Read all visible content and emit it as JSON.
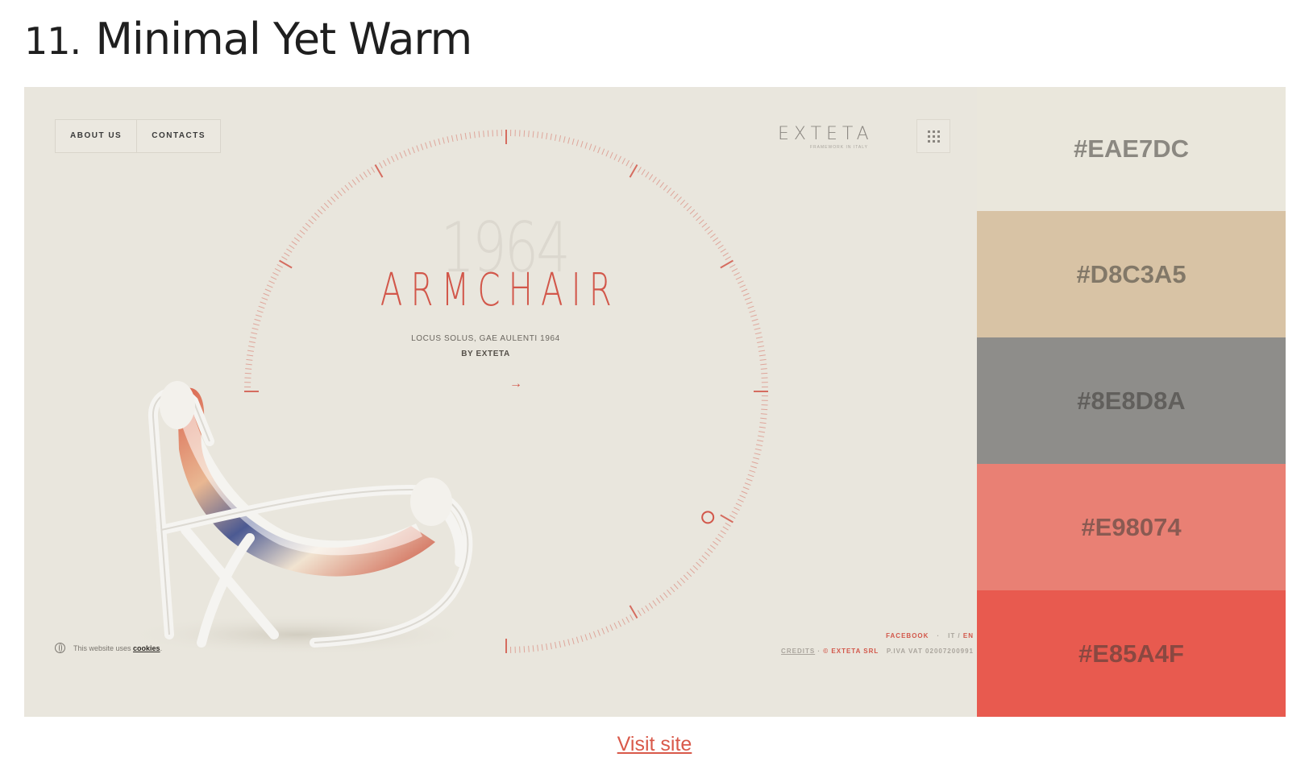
{
  "article": {
    "number": "11.",
    "title": "Minimal Yet Warm",
    "visit_link": "Visit site"
  },
  "site": {
    "nav": [
      "ABOUT US",
      "CONTACTS"
    ],
    "logo": "EXTETA",
    "logo_tagline": "FRAMEWORK IN ITALY",
    "menu_icon": "grid-dots-icon",
    "year": "1964",
    "product_title": "ARMCHAIR",
    "subtitle": "LOCUS SOLUS, GAE AULENTI 1964",
    "byline": "BY EXTETA",
    "arrow": "→",
    "cookie_text": "This website uses",
    "cookie_link": "cookies",
    "footer": {
      "facebook": "FACEBOOK",
      "separator": "·",
      "lang_it": "IT",
      "lang_slash": " / ",
      "lang_en": "EN",
      "credits": "CREDITS",
      "company": "© EXTETA SRL",
      "vat": "P.IVA VAT 02007200991"
    },
    "accent_color": "#d2574a"
  },
  "palette": [
    {
      "label": "#EAE7DC",
      "color": "#EAE7DC"
    },
    {
      "label": "#D8C3A5",
      "color": "#D8C3A5"
    },
    {
      "label": "#8E8D8A",
      "color": "#8E8D8A"
    },
    {
      "label": "#E98074",
      "color": "#E98074"
    },
    {
      "label": "#E85A4F",
      "color": "#E85A4F"
    }
  ]
}
